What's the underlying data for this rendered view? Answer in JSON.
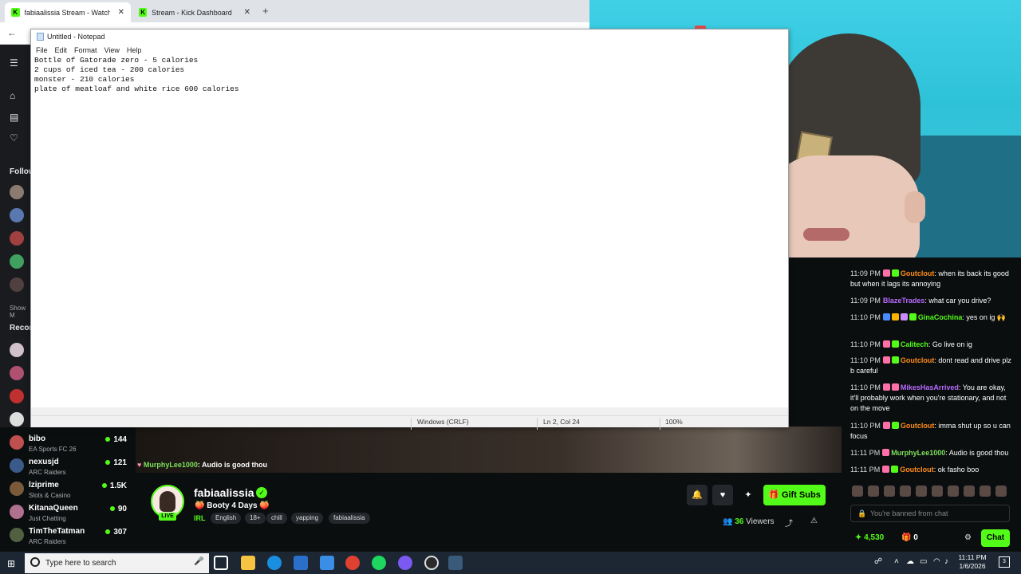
{
  "browser": {
    "tabs": [
      {
        "title": "fabiaalissia Stream - Watch Live",
        "active": true
      },
      {
        "title": "Stream - Kick Dashboard",
        "active": false
      }
    ],
    "new_tab": "+",
    "back": "←"
  },
  "notepad": {
    "title": "Untitled - Notepad",
    "menu": [
      "File",
      "Edit",
      "Format",
      "View",
      "Help"
    ],
    "lines": [
      "Bottle of Gatorade zero - 5 calories",
      "2 cups of iced tea - 200 calories",
      "monster - 210 calories",
      "plate of meatloaf and white rice 600 calories"
    ],
    "status": {
      "line_ending": "Windows (CRLF)",
      "position": "Ln 2, Col 24",
      "zoom": "100%"
    }
  },
  "left_nav": {
    "labels": [
      "Follow",
      "Show M",
      "Recom"
    ]
  },
  "sidebar": {
    "channels": [
      {
        "name": "bibo",
        "category": "EA Sports FC 26",
        "viewers": "144"
      },
      {
        "name": "nexusjd",
        "category": "ARC Raiders",
        "viewers": "121"
      },
      {
        "name": "lziprime",
        "category": "Slots & Casino",
        "viewers": "1.5K"
      },
      {
        "name": "KitanaQueen",
        "category": "Just Chatting",
        "viewers": "90"
      },
      {
        "name": "TimTheTatman",
        "category": "ARC Raiders",
        "viewers": "307"
      }
    ]
  },
  "overlay_chat": {
    "user": "MurphyLee1000",
    "text": ": Audio is good thou"
  },
  "channel": {
    "name": "fabiaalissia",
    "live_label": "LIVE",
    "title": "🍑 Booty 4 Days 🍑",
    "category": "IRL",
    "tags": [
      "English",
      "18+",
      "chill",
      "yapping",
      "fabiaalissia"
    ],
    "gift_label": "Gift Subs",
    "viewers_count": "36",
    "viewers_label": "Viewers"
  },
  "chat": {
    "messages": [
      {
        "time": "11:09 PM",
        "user": "Goutclout",
        "color": "#ff8c1a",
        "text": ": when its back its good but when it lags its annoying"
      },
      {
        "time": "11:09 PM",
        "user": "BlazeTrades",
        "color": "#b86bff",
        "text": ": what car you drive?"
      },
      {
        "time": "11:10 PM",
        "user": "GinaCochina",
        "color": "#53fc18",
        "text": ": yes on ig 🙌"
      },
      {
        "time": "11:10 PM",
        "user": "Calitech",
        "color": "#53fc18",
        "text": ": Go live on ig"
      },
      {
        "time": "11:10 PM",
        "user": "Goutclout",
        "color": "#ff8c1a",
        "text": ": dont read and drive plz b careful"
      },
      {
        "time": "11:10 PM",
        "user": "MikesHasArrived",
        "color": "#b86bff",
        "text": ": You are okay, it'll probably work when you're stationary, and not on the move"
      },
      {
        "time": "11:10 PM",
        "user": "Goutclout",
        "color": "#ff8c1a",
        "text": ": imma shut up so u can focus"
      },
      {
        "time": "11:11 PM",
        "user": "MurphyLee1000",
        "color": "#7de35b",
        "text": ": Audio is good thou"
      },
      {
        "time": "11:11 PM",
        "user": "Goutclout",
        "color": "#ff8c1a",
        "text": ": ok fasho boo"
      }
    ],
    "banned_text": "You're banned from chat",
    "points": "4,530",
    "gifts": "0",
    "chat_button": "Chat"
  },
  "taskbar": {
    "search_placeholder": "Type here to search",
    "time": "11:11 PM",
    "date": "1/6/2026",
    "notif_count": "3"
  }
}
